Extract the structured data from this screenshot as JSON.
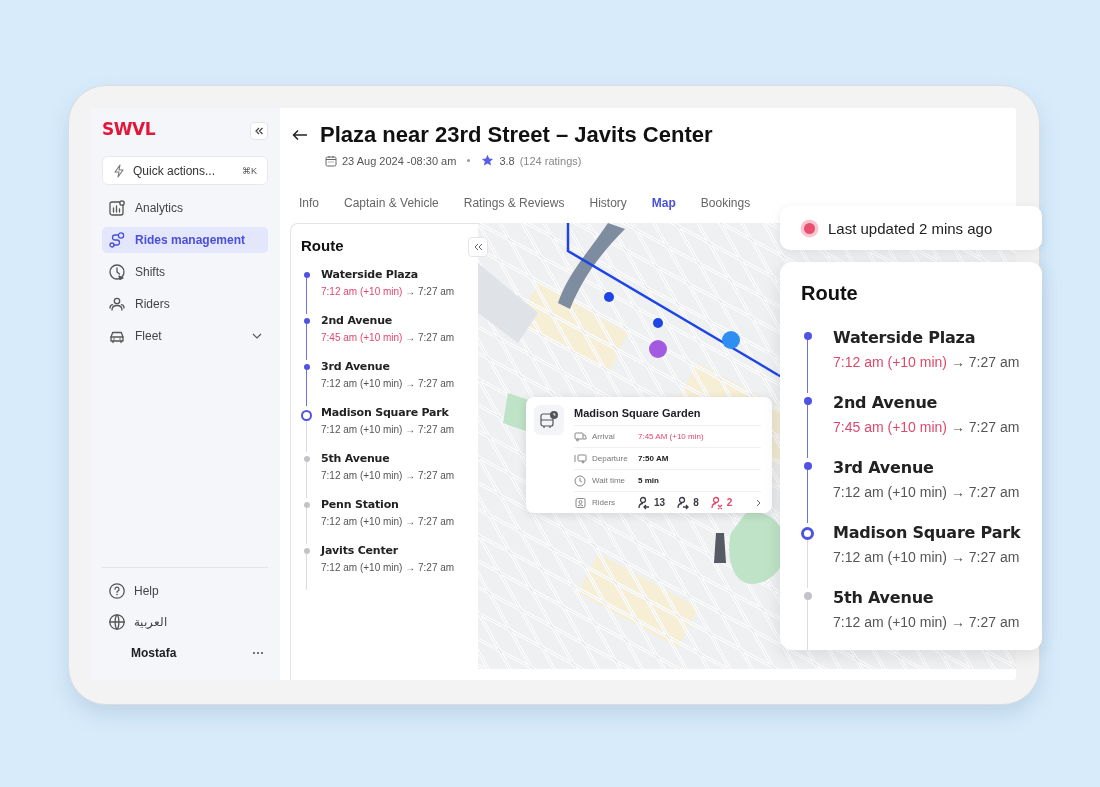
{
  "sidebar": {
    "logo": "SWVL",
    "quick_actions": {
      "label": "Quick actions...",
      "shortcut": "⌘K"
    },
    "nav": [
      {
        "label": "Analytics",
        "selected": false,
        "expandable": false
      },
      {
        "label": "Rides management",
        "selected": true,
        "expandable": false
      },
      {
        "label": "Shifts",
        "selected": false,
        "expandable": false
      },
      {
        "label": "Riders",
        "selected": false,
        "expandable": false
      },
      {
        "label": "Fleet",
        "selected": false,
        "expandable": true
      }
    ],
    "footer": [
      {
        "label": "Help"
      },
      {
        "label": "العربية"
      }
    ],
    "user": {
      "name": "Mostafa"
    }
  },
  "header": {
    "title": "Plaza near 23rd Street – Javits Center",
    "date": "23 Aug 2024 -08:30 am",
    "rating": "3.8",
    "rating_count": "(124 ratings)"
  },
  "tabs": [
    {
      "label": "Info",
      "selected": false
    },
    {
      "label": "Captain & Vehicle",
      "selected": false
    },
    {
      "label": "Ratings & Reviews",
      "selected": false
    },
    {
      "label": "History",
      "selected": false
    },
    {
      "label": "Map",
      "selected": true
    },
    {
      "label": "Bookings",
      "selected": false
    }
  ],
  "route": {
    "title": "Route",
    "stops": [
      {
        "name": "Waterside Plaza",
        "reached": true,
        "current": false,
        "time": "7:12 am (+10 min)",
        "late": true,
        "arrival": "→ 7:27 am"
      },
      {
        "name": "2nd Avenue",
        "reached": true,
        "current": false,
        "time": "7:45 am (+10 min)",
        "late": true,
        "arrival": "→ 7:27 am"
      },
      {
        "name": "3rd Avenue",
        "reached": true,
        "current": false,
        "time": "7:12 am (+10 min)",
        "late": false,
        "arrival": "→ 7:27 am"
      },
      {
        "name": "Madison Square Park",
        "reached": true,
        "current": true,
        "time": "7:12 am (+10 min)",
        "late": false,
        "arrival": "→ 7:27 am"
      },
      {
        "name": "5th Avenue",
        "reached": false,
        "current": false,
        "time": "7:12 am (+10 min)",
        "late": false,
        "arrival": "→ 7:27 am"
      },
      {
        "name": "Penn Station",
        "reached": false,
        "current": false,
        "time": "7:12 am (+10 min)",
        "late": false,
        "arrival": "→ 7:27 am"
      },
      {
        "name": "Javits Center",
        "reached": false,
        "current": false,
        "time": "7:12 am (+10 min)",
        "late": false,
        "arrival": "→ 7:27 am"
      }
    ]
  },
  "map": {
    "kind": "picture",
    "popup": {
      "title": "Madison Square Garden",
      "rows": [
        {
          "kind": "value",
          "label": "Arrival",
          "value": "7:45 AM (+10 min)",
          "late": true
        },
        {
          "kind": "value",
          "label": "Departure",
          "value": "7:50 AM",
          "late": false
        },
        {
          "kind": "value",
          "label": "Wait time",
          "value": "5 min",
          "late": false
        },
        {
          "kind": "counts",
          "label": "Riders",
          "counts": [
            {
              "value": "13",
              "color": "#3c3c46"
            },
            {
              "value": "8",
              "color": "#3c3c46"
            },
            {
              "value": "2",
              "color": "#e0476c"
            }
          ]
        }
      ]
    }
  },
  "status_badge": {
    "text": "Last updated 2 mins ago"
  },
  "route_card": {
    "title": "Route",
    "stops": [
      {
        "name": "Waterside Plaza",
        "reached": true,
        "current": false,
        "time": "7:12 am (+10 min)",
        "late": true,
        "arrival": "→ 7:27 am"
      },
      {
        "name": "2nd Avenue",
        "reached": true,
        "current": false,
        "time": "7:45 am (+10 min)",
        "late": true,
        "arrival": "→ 7:27 am"
      },
      {
        "name": "3rd Avenue",
        "reached": true,
        "current": false,
        "time": "7:12 am (+10 min)",
        "late": false,
        "arrival": "→ 7:27 am"
      },
      {
        "name": "Madison Square Park",
        "reached": true,
        "current": true,
        "time": "7:12 am (+10 min)",
        "late": false,
        "arrival": "→ 7:27 am"
      },
      {
        "name": "5th Avenue",
        "reached": false,
        "current": false,
        "time": "7:12 am (+10 min)",
        "late": false,
        "arrival": "→ 7:27 am"
      }
    ]
  }
}
